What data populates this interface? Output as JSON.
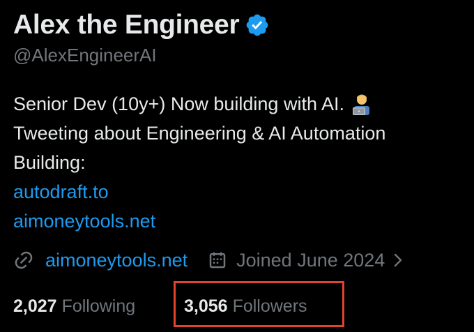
{
  "profile": {
    "display_name": "Alex the Engineer",
    "handle": "@AlexEngineerAI",
    "verified": true,
    "verified_icon": "verified-badge-icon"
  },
  "bio": {
    "line1": "Senior Dev (10y+) Now building with AI.",
    "line1_emoji": "technologist-emoji",
    "line2": "Tweeting about Engineering & AI Automation",
    "line3": "Building:",
    "link1": "autodraft.to",
    "link2": "aimoneytools.net"
  },
  "meta": {
    "website_icon": "link-icon",
    "website": "aimoneytools.net",
    "joined_icon": "calendar-icon",
    "joined": "Joined June 2024",
    "more_icon": "chevron-right-icon"
  },
  "stats": {
    "following_count": "2,027",
    "following_label": "Following",
    "followers_count": "3,056",
    "followers_label": "Followers"
  },
  "colors": {
    "background": "#000000",
    "text_primary": "#e7e9ea",
    "text_secondary": "#71767b",
    "link": "#1d9bf0",
    "verified": "#1d9bf0",
    "highlight": "#e0442c"
  }
}
